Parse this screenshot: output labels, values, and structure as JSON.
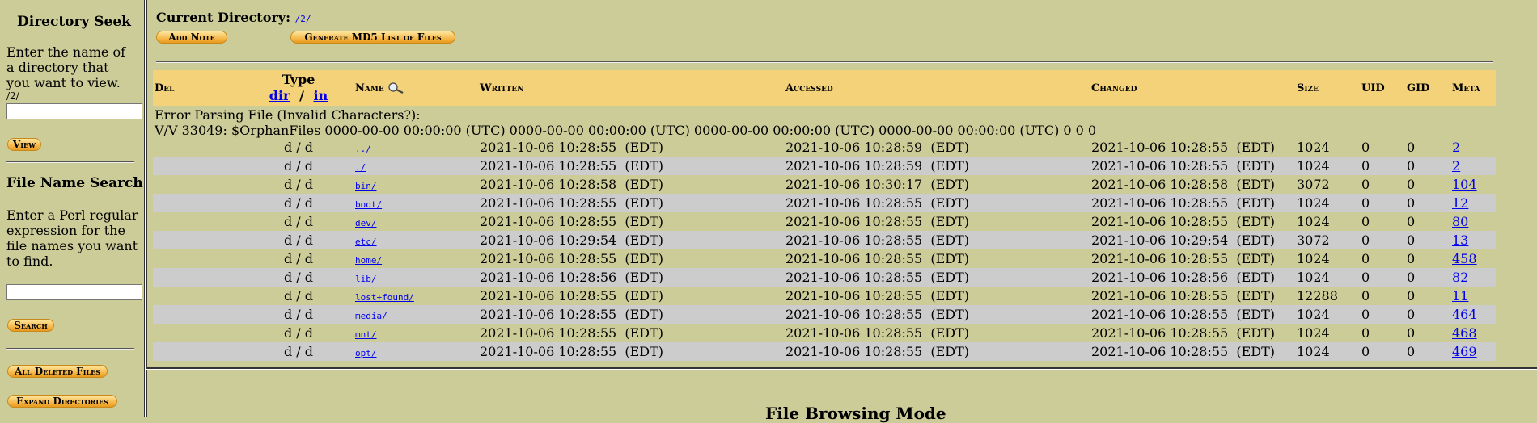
{
  "sidebar": {
    "dir_seek_title": "Directory Seek",
    "dir_seek_text": "Enter the name of a directory that you want to view.",
    "dir_seek_current": "/2/",
    "dir_input_value": "",
    "view_button": "View",
    "file_search_title": "File Name Search",
    "file_search_text": "Enter a Perl regular expression for the file names you want to find.",
    "file_input_value": "",
    "search_button": "Search",
    "all_deleted_button": "All Deleted Files",
    "expand_dirs_button": "Expand Directories"
  },
  "header": {
    "current_dir_label": "Current Directory:",
    "current_dir_link": "/2/",
    "add_note_button": "Add Note",
    "md5_button": "Generate MD5 List of Files"
  },
  "table": {
    "col_del": "Del",
    "col_type": "Type",
    "col_type_dir": "dir",
    "col_type_sep": "/",
    "col_type_in": "in",
    "col_name": "Name",
    "col_written": "Written",
    "col_accessed": "Accessed",
    "col_changed": "Changed",
    "col_size": "Size",
    "col_uid": "UID",
    "col_gid": "GID",
    "col_meta": "Meta",
    "error_line1": "Error Parsing File (Invalid Characters?):",
    "error_line2": "V/V 33049: $OrphanFiles 0000-00-00 00:00:00 (UTC) 0000-00-00 00:00:00 (UTC) 0000-00-00 00:00:00 (UTC) 0000-00-00 00:00:00 (UTC) 0 0 0",
    "rows": [
      {
        "type": "d / d",
        "name": "../",
        "written": "2021-10-06 10:28:55  (EDT)",
        "accessed": "2021-10-06 10:28:59  (EDT)",
        "changed": "2021-10-06 10:28:55  (EDT)",
        "size": "1024",
        "uid": "0",
        "gid": "0",
        "meta": "2"
      },
      {
        "type": "d / d",
        "name": "./",
        "written": "2021-10-06 10:28:55  (EDT)",
        "accessed": "2021-10-06 10:28:59  (EDT)",
        "changed": "2021-10-06 10:28:55  (EDT)",
        "size": "1024",
        "uid": "0",
        "gid": "0",
        "meta": "2"
      },
      {
        "type": "d / d",
        "name": "bin/",
        "written": "2021-10-06 10:28:58  (EDT)",
        "accessed": "2021-10-06 10:30:17  (EDT)",
        "changed": "2021-10-06 10:28:58  (EDT)",
        "size": "3072",
        "uid": "0",
        "gid": "0",
        "meta": "104"
      },
      {
        "type": "d / d",
        "name": "boot/",
        "written": "2021-10-06 10:28:55  (EDT)",
        "accessed": "2021-10-06 10:28:55  (EDT)",
        "changed": "2021-10-06 10:28:55  (EDT)",
        "size": "1024",
        "uid": "0",
        "gid": "0",
        "meta": "12"
      },
      {
        "type": "d / d",
        "name": "dev/",
        "written": "2021-10-06 10:28:55  (EDT)",
        "accessed": "2021-10-06 10:28:55  (EDT)",
        "changed": "2021-10-06 10:28:55  (EDT)",
        "size": "1024",
        "uid": "0",
        "gid": "0",
        "meta": "80"
      },
      {
        "type": "d / d",
        "name": "etc/",
        "written": "2021-10-06 10:29:54  (EDT)",
        "accessed": "2021-10-06 10:28:55  (EDT)",
        "changed": "2021-10-06 10:29:54  (EDT)",
        "size": "3072",
        "uid": "0",
        "gid": "0",
        "meta": "13"
      },
      {
        "type": "d / d",
        "name": "home/",
        "written": "2021-10-06 10:28:55  (EDT)",
        "accessed": "2021-10-06 10:28:55  (EDT)",
        "changed": "2021-10-06 10:28:55  (EDT)",
        "size": "1024",
        "uid": "0",
        "gid": "0",
        "meta": "458"
      },
      {
        "type": "d / d",
        "name": "lib/",
        "written": "2021-10-06 10:28:56  (EDT)",
        "accessed": "2021-10-06 10:28:55  (EDT)",
        "changed": "2021-10-06 10:28:56  (EDT)",
        "size": "1024",
        "uid": "0",
        "gid": "0",
        "meta": "82"
      },
      {
        "type": "d / d",
        "name": "lost+found/",
        "written": "2021-10-06 10:28:55  (EDT)",
        "accessed": "2021-10-06 10:28:55  (EDT)",
        "changed": "2021-10-06 10:28:55  (EDT)",
        "size": "12288",
        "uid": "0",
        "gid": "0",
        "meta": "11"
      },
      {
        "type": "d / d",
        "name": "media/",
        "written": "2021-10-06 10:28:55  (EDT)",
        "accessed": "2021-10-06 10:28:55  (EDT)",
        "changed": "2021-10-06 10:28:55  (EDT)",
        "size": "1024",
        "uid": "0",
        "gid": "0",
        "meta": "464"
      },
      {
        "type": "d / d",
        "name": "mnt/",
        "written": "2021-10-06 10:28:55  (EDT)",
        "accessed": "2021-10-06 10:28:55  (EDT)",
        "changed": "2021-10-06 10:28:55  (EDT)",
        "size": "1024",
        "uid": "0",
        "gid": "0",
        "meta": "468"
      },
      {
        "type": "d / d",
        "name": "opt/",
        "written": "2021-10-06 10:28:55  (EDT)",
        "accessed": "2021-10-06 10:28:55  (EDT)",
        "changed": "2021-10-06 10:28:55  (EDT)",
        "size": "1024",
        "uid": "0",
        "gid": "0",
        "meta": "469"
      }
    ]
  },
  "footer": {
    "browse_title": "File Browsing Mode"
  }
}
